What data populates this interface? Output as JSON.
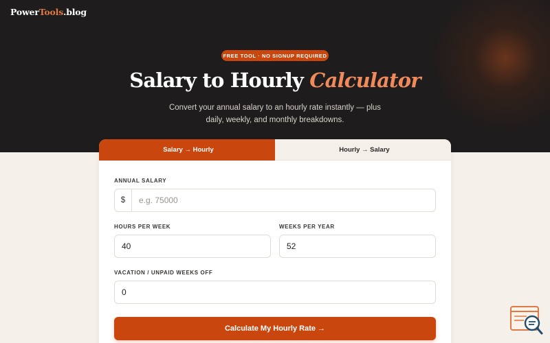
{
  "brand": {
    "part1": "Power",
    "part2": "Tools",
    "part3": ".blog"
  },
  "hero": {
    "badge": "FREE TOOL · NO SIGNUP REQUIRED",
    "title_main": "Salary to Hourly",
    "title_accent": "Calculator",
    "subtitle": "Convert your annual salary to an hourly rate instantly — plus daily, weekly, and monthly breakdowns."
  },
  "tabs": [
    {
      "icon": "",
      "label": "Salary → Hourly",
      "active": true
    },
    {
      "icon": "",
      "label": "Hourly → Salary",
      "active": false
    }
  ],
  "form": {
    "annual_salary": {
      "label": "ANNUAL SALARY",
      "prefix": "$",
      "placeholder": "e.g. 75000",
      "value": ""
    },
    "hours_per_week": {
      "label": "HOURS PER WEEK",
      "value": "40"
    },
    "weeks_per_year": {
      "label": "WEEKS PER YEAR",
      "value": "52"
    },
    "vacation_weeks": {
      "label": "VACATION / UNPAID WEEKS OFF",
      "value": "0"
    },
    "submit_label": "Calculate My Hourly Rate →"
  },
  "colors": {
    "accent": "#c9470f",
    "hero_bg": "#1e1c1c",
    "page_bg": "#f5f1ea",
    "title_accent": "#f08a5a"
  },
  "icons": {
    "floating_widget": "search-chat-icon"
  }
}
